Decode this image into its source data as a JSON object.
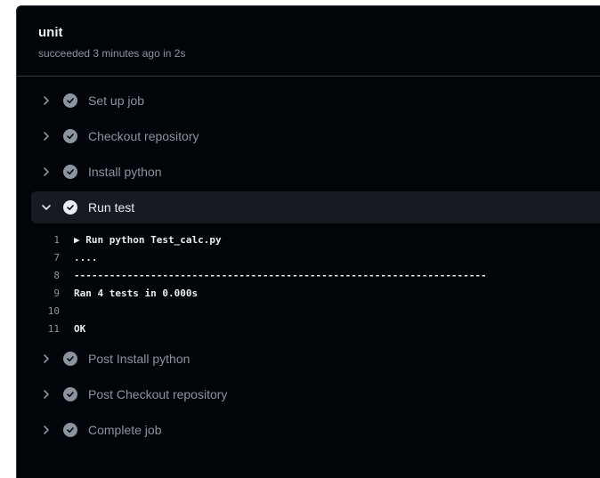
{
  "job": {
    "title": "unit",
    "status": "succeeded 3 minutes ago in 2s"
  },
  "steps_before": [
    {
      "label": "Set up job"
    },
    {
      "label": "Checkout repository"
    },
    {
      "label": "Install python"
    }
  ],
  "open_step": {
    "label": "Run test",
    "log": [
      {
        "num": "1",
        "text": "▶ Run python Test_calc.py"
      },
      {
        "num": "7",
        "text": "...."
      },
      {
        "num": "8",
        "text": "----------------------------------------------------------------------"
      },
      {
        "num": "9",
        "text": "Ran 4 tests in 0.000s"
      },
      {
        "num": "10",
        "text": ""
      },
      {
        "num": "11",
        "text": "OK"
      }
    ]
  },
  "steps_after": [
    {
      "label": "Post Install python"
    },
    {
      "label": "Post Checkout repository"
    },
    {
      "label": "Complete job"
    }
  ],
  "colors": {
    "background": "#010409",
    "step_open_bg": "#161b22",
    "muted": "#8b949e",
    "text": "#e6edf3"
  },
  "icons": {
    "step_status": "check-circle-icon",
    "collapsed": "chevron-right-icon",
    "expanded": "chevron-down-icon"
  }
}
